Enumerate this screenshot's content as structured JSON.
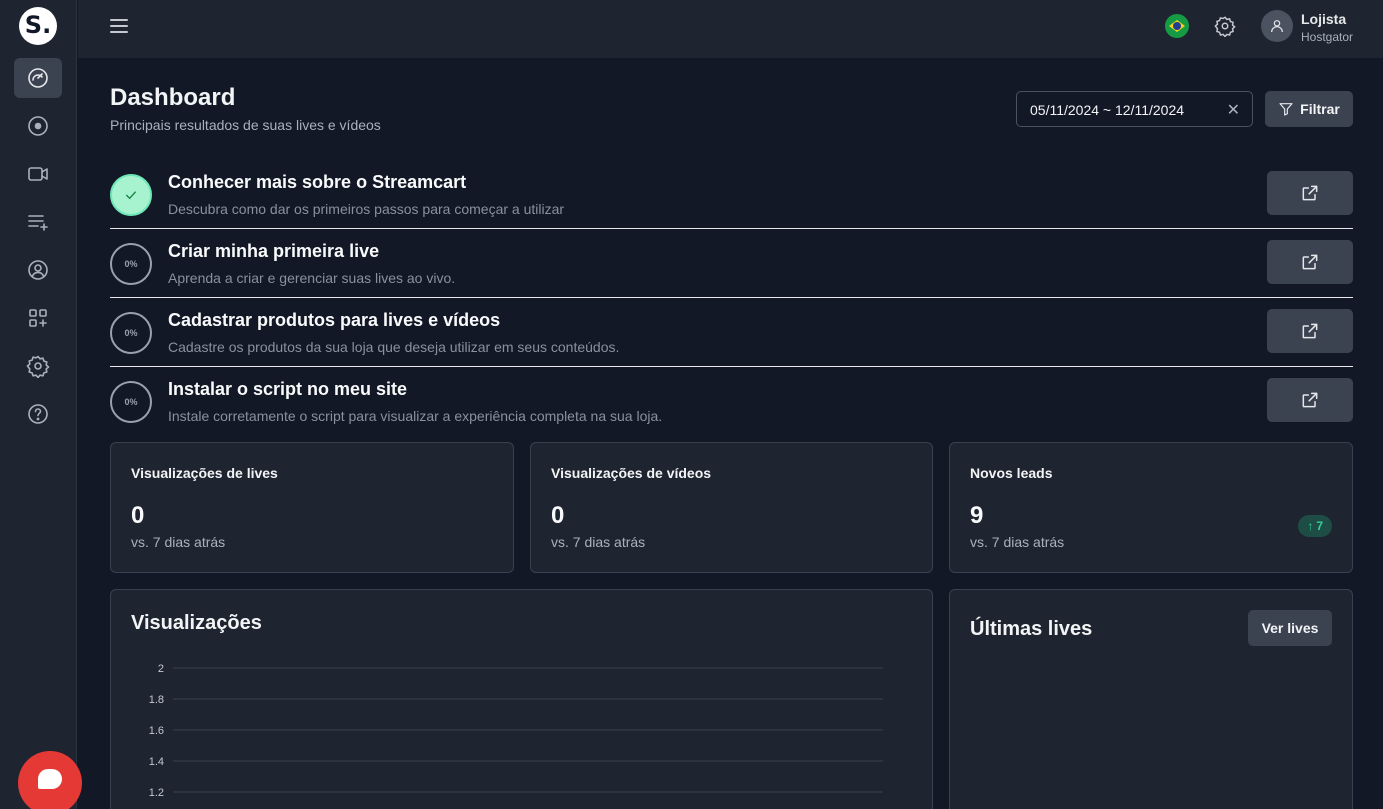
{
  "app": {
    "logo_text": "S."
  },
  "sidebar": {
    "items": [
      {
        "icon": "gauge-icon",
        "active": true
      },
      {
        "icon": "live-record-icon",
        "active": false
      },
      {
        "icon": "video-camera-icon",
        "active": false
      },
      {
        "icon": "playlist-add-icon",
        "active": false
      },
      {
        "icon": "user-circle-icon",
        "active": false
      },
      {
        "icon": "apps-add-icon",
        "active": false
      },
      {
        "icon": "gear-icon",
        "active": false
      },
      {
        "icon": "help-circle-icon",
        "active": false
      }
    ]
  },
  "topbar": {
    "user_name": "Lojista",
    "user_store": "Hostgator",
    "language_icon": "brazil-flag-icon"
  },
  "header": {
    "title": "Dashboard",
    "subtitle": "Principais resultados de suas lives e vídeos",
    "date_range": "05/11/2024 ~ 12/11/2024",
    "clear_symbol": "✕",
    "filter_label": "Filtrar"
  },
  "steps": [
    {
      "title": "Conhecer mais sobre o Streamcart",
      "description": "Descubra como dar os primeiros passos para começar a utilizar",
      "done": true,
      "progress": ""
    },
    {
      "title": "Criar minha primeira live",
      "description": "Aprenda a criar e gerenciar suas lives ao vivo.",
      "done": false,
      "progress": "0%"
    },
    {
      "title": "Cadastrar produtos para lives e vídeos",
      "description": "Cadastre os produtos da sua loja que deseja utilizar em seus conteúdos.",
      "done": false,
      "progress": "0%"
    },
    {
      "title": "Instalar o script no meu site",
      "description": "Instale corretamente o script para visualizar a experiência completa na sua loja.",
      "done": false,
      "progress": "0%"
    }
  ],
  "stats": [
    {
      "label": "Visualizações de lives",
      "value": "0",
      "comparison": "vs. 7 dias atrás"
    },
    {
      "label": "Visualizações de vídeos",
      "value": "0",
      "comparison": "vs. 7 dias atrás"
    },
    {
      "label": "Novos leads",
      "value": "9",
      "comparison": "vs. 7 dias atrás",
      "trend": "7",
      "trend_symbol": "↑",
      "trend_color": "#34d399"
    }
  ],
  "views_panel": {
    "title": "Visualizações"
  },
  "lives_panel": {
    "title": "Últimas lives",
    "button_label": "Ver lives"
  },
  "chart_data": {
    "type": "line",
    "title": "Visualizações",
    "yticks": [
      "2",
      "1.8",
      "1.6",
      "1.4",
      "1.2"
    ],
    "grid": true
  }
}
